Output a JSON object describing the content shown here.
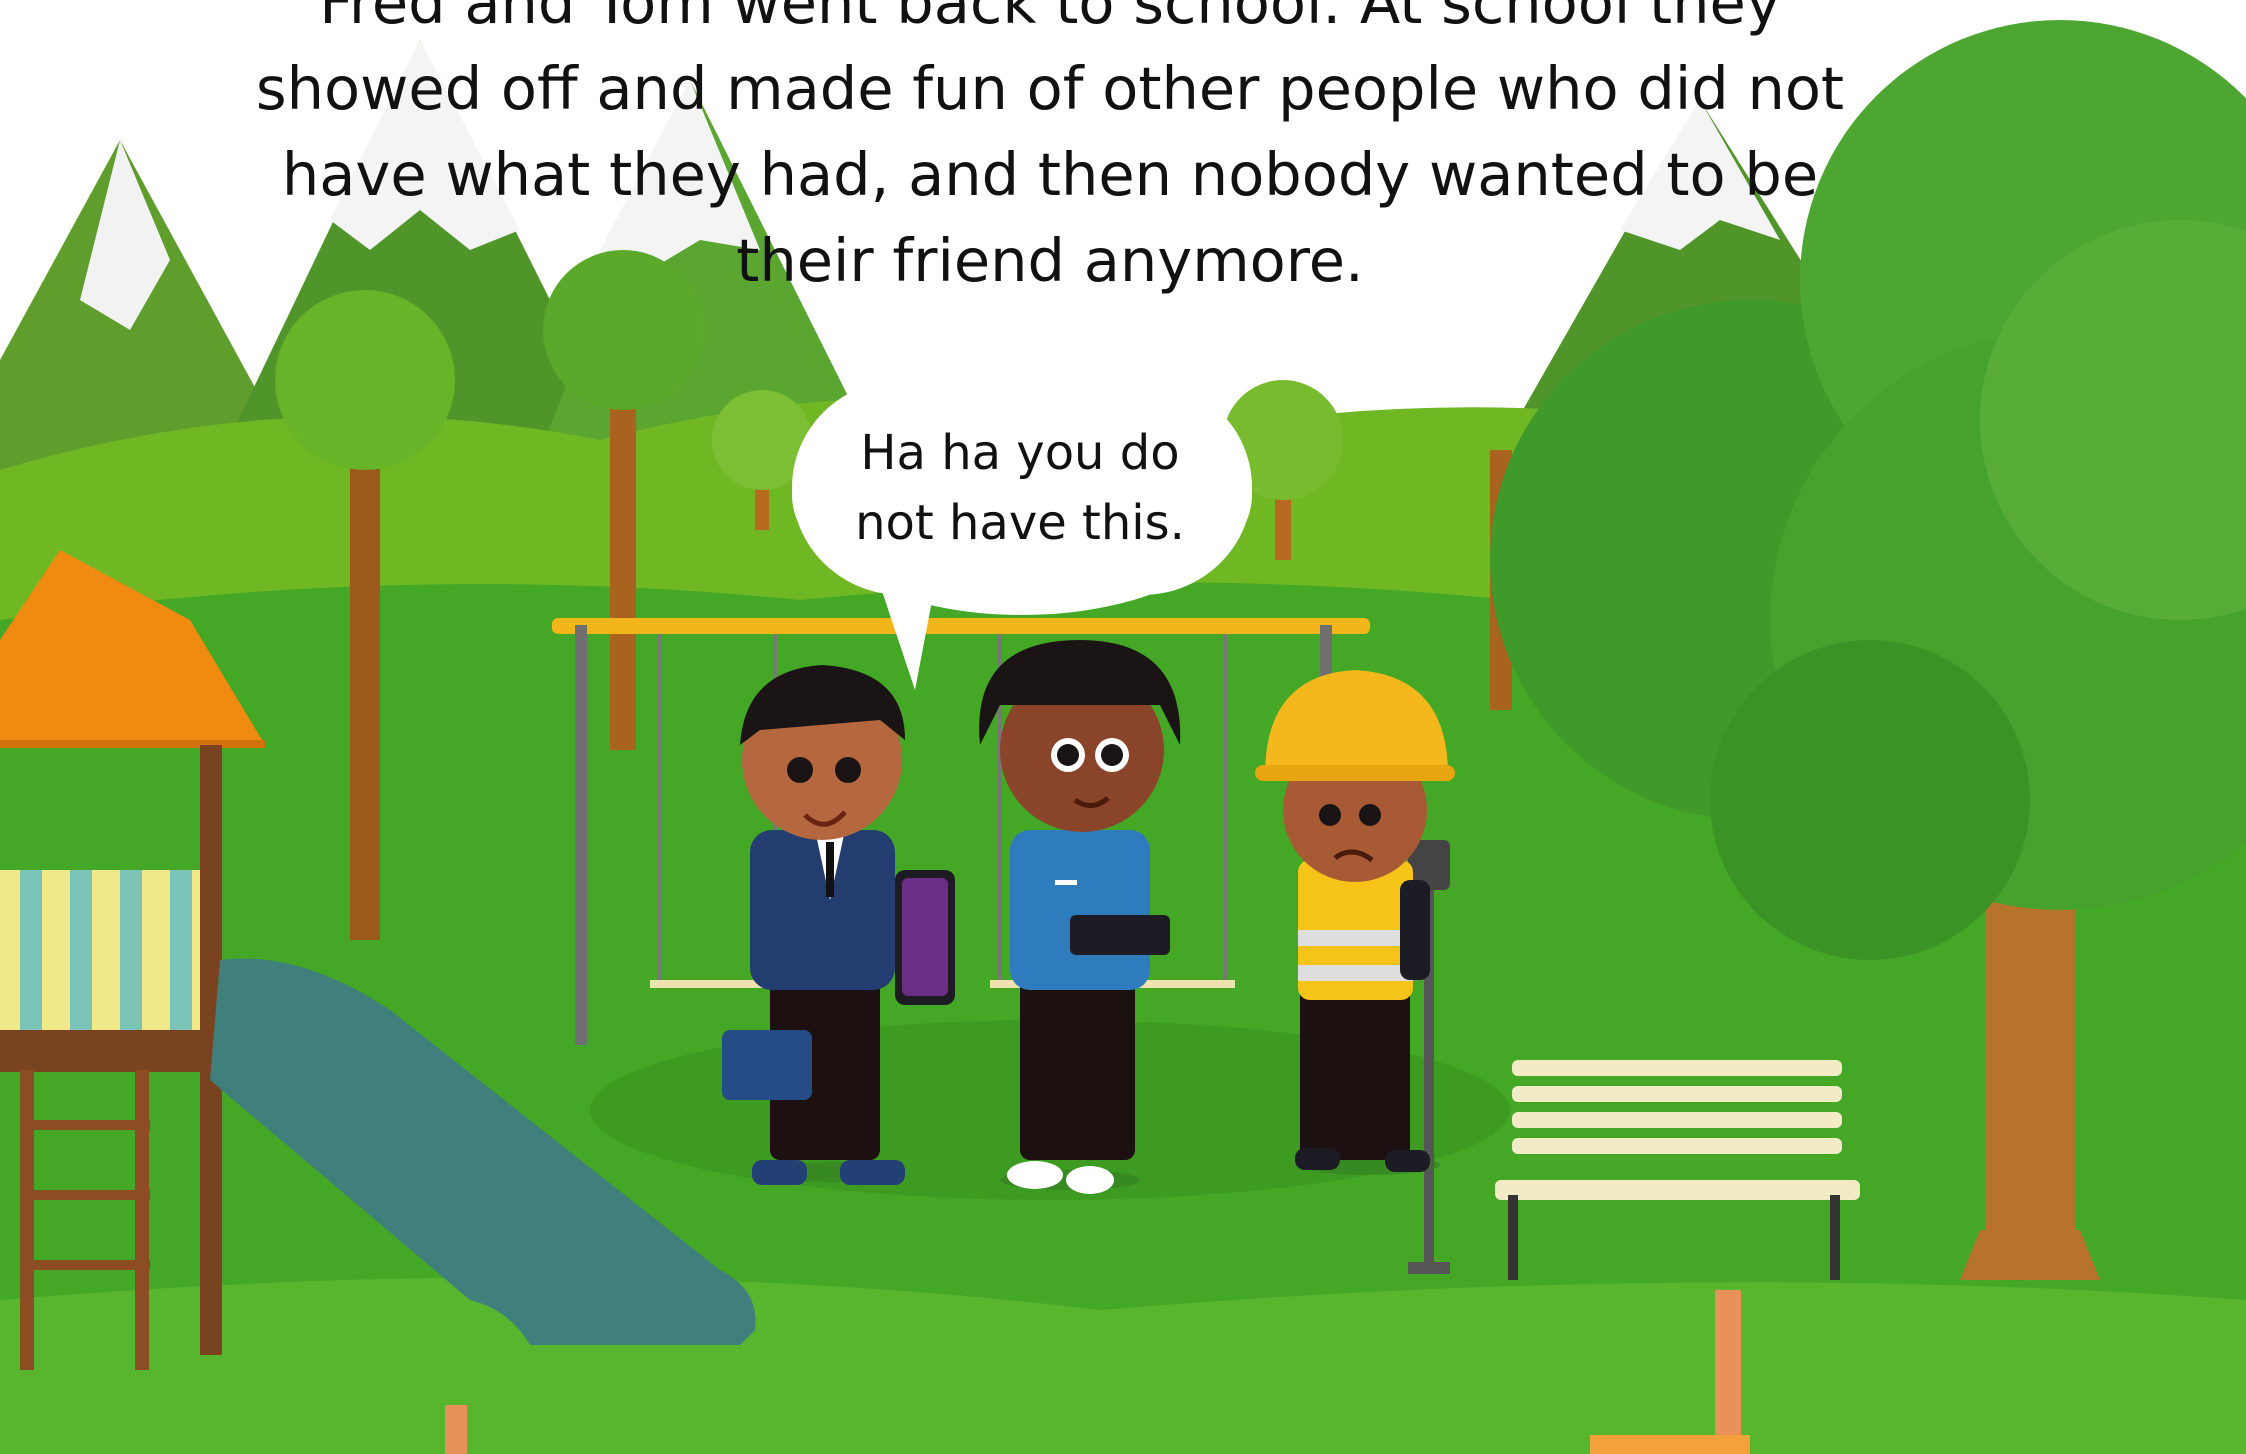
{
  "narration": {
    "line1": "Fred and Tom went back to school.  At school they",
    "line2": "showed off and made fun of other people who did not",
    "line3": "have what they had, and then nobody wanted to be",
    "line4": "their friend anymore."
  },
  "speech_bubble": {
    "line1": "Ha ha you do",
    "line2": "not have this."
  },
  "colors": {
    "sky": "#ffffff",
    "grass": "#3fa424",
    "grass_light": "#7dc21e",
    "mountain": "#4e9b2a",
    "tree_foliage": "#4a9e2c",
    "trunk": "#b56a1d",
    "slide": "#3f7f7c",
    "roof": "#f08a10",
    "swing_bar": "#f2b51a",
    "hardhat": "#f4b81c"
  }
}
